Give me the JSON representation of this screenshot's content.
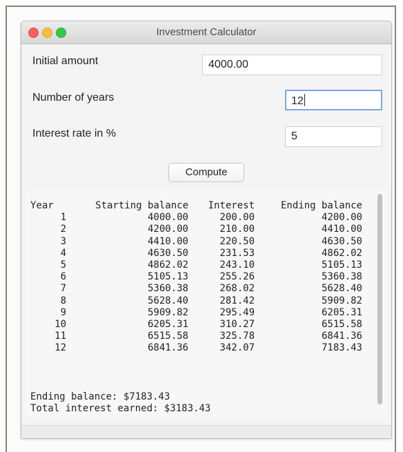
{
  "window": {
    "title": "Investment Calculator"
  },
  "form": {
    "initial_amount_label": "Initial amount",
    "initial_amount_value": "4000.00",
    "years_label": "Number of years",
    "years_value": "12",
    "rate_label": "Interest rate in %",
    "rate_value": "5",
    "compute_label": "Compute"
  },
  "results": {
    "headers": [
      "Year",
      "Starting balance",
      "Interest",
      "Ending balance"
    ],
    "rows": [
      [
        "1",
        "4000.00",
        "200.00",
        "4200.00"
      ],
      [
        "2",
        "4200.00",
        "210.00",
        "4410.00"
      ],
      [
        "3",
        "4410.00",
        "220.50",
        "4630.50"
      ],
      [
        "4",
        "4630.50",
        "231.53",
        "4862.02"
      ],
      [
        "5",
        "4862.02",
        "243.10",
        "5105.13"
      ],
      [
        "6",
        "5105.13",
        "255.26",
        "5360.38"
      ],
      [
        "7",
        "5360.38",
        "268.02",
        "5628.40"
      ],
      [
        "8",
        "5628.40",
        "281.42",
        "5909.82"
      ],
      [
        "9",
        "5909.82",
        "295.49",
        "6205.31"
      ],
      [
        "10",
        "6205.31",
        "310.27",
        "6515.58"
      ],
      [
        "11",
        "6515.58",
        "325.78",
        "6841.36"
      ],
      [
        "12",
        "6841.36",
        "342.07",
        "7183.43"
      ]
    ],
    "ending_balance": "Ending balance: $7183.43",
    "total_interest": "Total interest earned: $3183.43"
  },
  "colors": {
    "close": "#fc605c",
    "minimize": "#fdbc40",
    "maximize": "#34c84a",
    "focus_ring": "#7aa7e0"
  }
}
